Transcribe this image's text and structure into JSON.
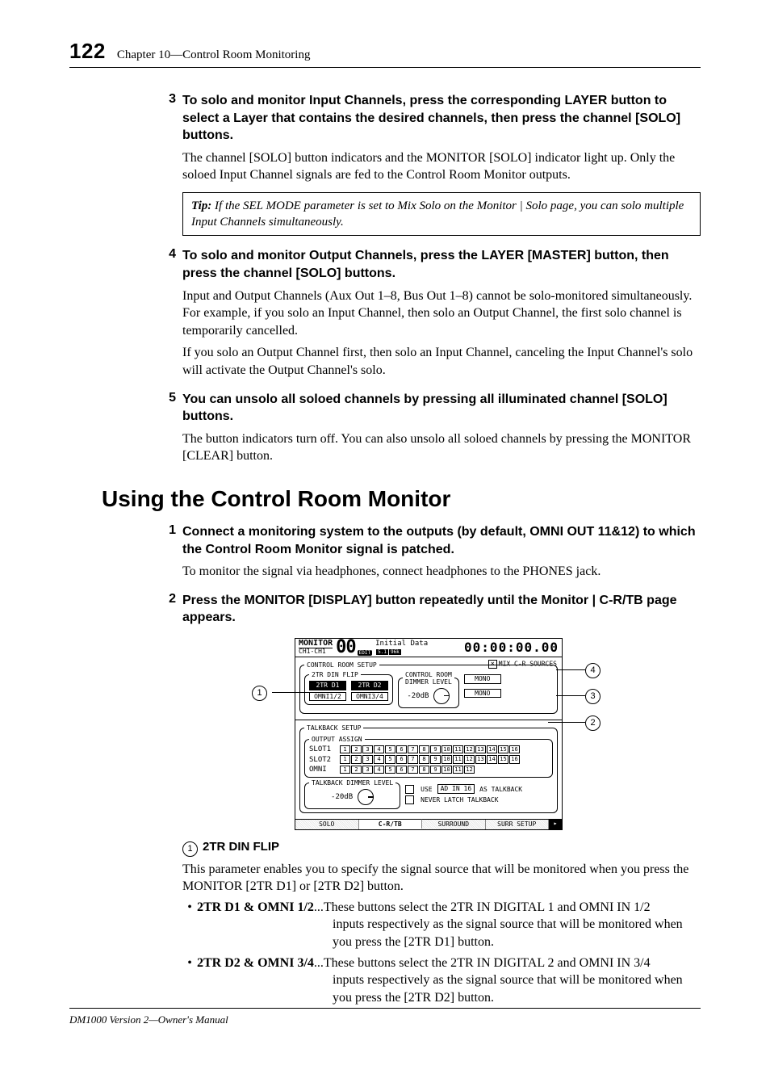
{
  "header": {
    "page_number": "122",
    "chapter": "Chapter 10—Control Room Monitoring"
  },
  "steps_a": [
    {
      "num": "3",
      "head": "To solo and monitor Input Channels, press the corresponding LAYER button to select a Layer that contains the desired channels, then press the channel [SOLO] buttons.",
      "body": [
        "The channel [SOLO] button indicators and the MONITOR [SOLO] indicator light up. Only the soloed Input Channel signals are fed to the Control Room Monitor outputs."
      ],
      "tip": "If the SEL MODE parameter is set to Mix Solo on the Monitor | Solo page, you can solo multiple Input Channels simultaneously."
    },
    {
      "num": "4",
      "head": "To solo and monitor Output Channels, press the LAYER [MASTER] button, then press the channel [SOLO] buttons.",
      "body": [
        "Input and Output Channels (Aux Out 1–8, Bus Out 1–8) cannot be solo-monitored simultaneously. For example, if you solo an Input Channel, then solo an Output Channel, the first solo channel is temporarily cancelled.",
        "If you solo an Output Channel first, then solo an Input Channel, canceling the Input Channel's solo will activate the Output Channel's solo."
      ]
    },
    {
      "num": "5",
      "head": "You can unsolo all soloed channels by pressing all illuminated channel [SOLO] buttons.",
      "body": [
        "The button indicators turn off. You can also unsolo all soloed channels by pressing the MONITOR [CLEAR] button."
      ]
    }
  ],
  "section_title": "Using the Control Room Monitor",
  "steps_b": [
    {
      "num": "1",
      "head": "Connect a monitoring system to the outputs (by default, OMNI OUT 11&12) to which the Control Room Monitor signal is patched.",
      "body": [
        "To monitor the signal via headphones, connect headphones to the PHONES jack."
      ]
    },
    {
      "num": "2",
      "head": "Press the MONITOR [DISPLAY] button repeatedly until the Monitor | C-R/TB page appears.",
      "body": []
    }
  ],
  "lcd": {
    "title": "MONITOR",
    "channel": "CH1-CH1",
    "scene_num": "00",
    "scene_name": "Initial Data",
    "edit": "EDIT",
    "badges": [
      "5.1",
      "96k"
    ],
    "timecode": "00:00:00.00",
    "control_room_setup": "CONTROL ROOM SETUP",
    "din_flip": "2TR DIN FLIP",
    "btn_2tr_d1": "2TR D1",
    "btn_2tr_d2": "2TR D2",
    "btn_omni12": "OMNI1/2",
    "btn_omni34": "OMNI3/4",
    "dimmer_label": "CONTROL ROOM\nDIMMER LEVEL",
    "dimmer_value": "-20dB",
    "mix_sources": "MIX C-R SOURCES",
    "mono": "MONO",
    "talkback_setup": "TALKBACK SETUP",
    "output_assign": "OUTPUT ASSIGN",
    "slot1": "SLOT1",
    "slot2": "SLOT2",
    "omni": "OMNI",
    "tb_dimmer": "TALKBACK DIMMER LEVEL",
    "tb_value": "-20dB",
    "tb_use": "USE",
    "tb_source": "AD IN 16",
    "tb_as": "AS TALKBACK",
    "tb_never": "NEVER LATCH TALKBACK",
    "tabs": [
      "SOLO",
      "C-R/TB",
      "SURROUND",
      "SURR SETUP"
    ],
    "nums16": [
      "1",
      "2",
      "3",
      "4",
      "5",
      "6",
      "7",
      "8",
      "9",
      "10",
      "11",
      "12",
      "13",
      "14",
      "15",
      "16"
    ],
    "nums12": [
      "1",
      "2",
      "3",
      "4",
      "5",
      "6",
      "7",
      "8",
      "9",
      "10",
      "11",
      "12"
    ]
  },
  "param": {
    "num": "1",
    "name": "2TR DIN FLIP",
    "desc": "This parameter enables you to specify the signal source that will be monitored when you press the MONITOR [2TR D1] or [2TR D2] button.",
    "bullets": [
      {
        "label": "2TR D1 & OMNI 1/2",
        "first": "...These buttons select the 2TR IN DIGITAL 1 and OMNI IN 1/2",
        "rest": [
          "inputs respectively as the signal source that will be monitored when you press the [2TR D1] button."
        ]
      },
      {
        "label": "2TR D2 & OMNI 3/4",
        "first": "...These buttons select the 2TR IN DIGITAL 2 and OMNI IN 3/4",
        "rest": [
          "inputs respectively as the signal source that will be monitored when you press the [2TR D2] button."
        ]
      }
    ]
  },
  "footer": "DM1000 Version 2—Owner's Manual"
}
